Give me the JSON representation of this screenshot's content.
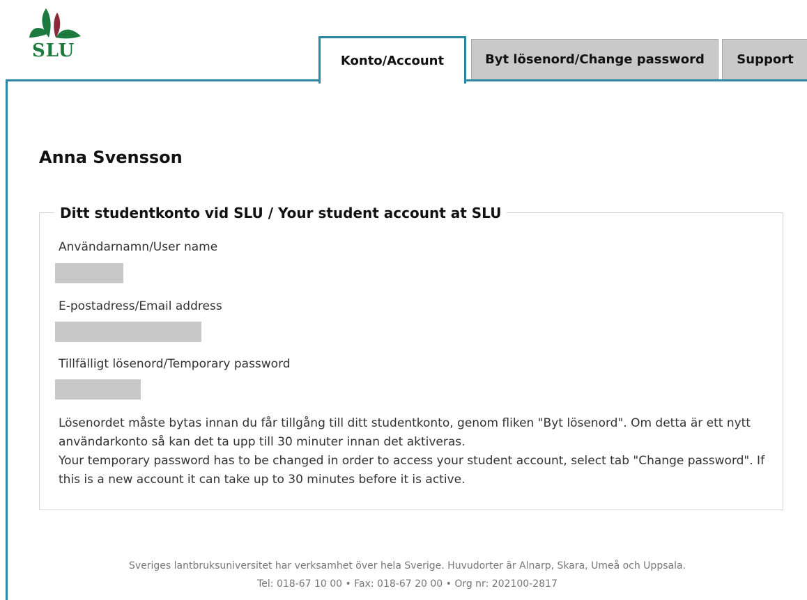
{
  "logo": {
    "text": "SLU"
  },
  "tabs": [
    {
      "label": "Konto/Account",
      "active": true
    },
    {
      "label": "Byt lösenord/Change password",
      "active": false
    },
    {
      "label": "Support",
      "active": false
    }
  ],
  "user": {
    "name": "Anna Svensson"
  },
  "account_panel": {
    "title": "Ditt studentkonto vid SLU / Your student account at SLU",
    "fields": [
      {
        "label": "Användarnamn/User name"
      },
      {
        "label": "E-postadress/Email address"
      },
      {
        "label": "Tillfälligt lösenord/Temporary password"
      }
    ],
    "info_sv": "Lösenordet måste bytas innan du får tillgång till ditt studentkonto, genom fliken \"Byt lösenord\". Om detta är ett nytt användarkonto så kan det ta upp till 30 minuter innan det aktiveras.",
    "info_en": "Your temporary password has to be changed in order to access your student account, select tab \"Change password\". If this is a new account it can take up to 30 minutes before it is active."
  },
  "footer": {
    "line1": "Sveriges lantbruksuniversitet har verksamhet över hela Sverige. Huvudorter är Alnarp, Skara, Umeå och Uppsala.",
    "line2": "Tel: 018-67 10 00 • Fax: 018-67 20 00 • Org nr: 202100-2817"
  },
  "colors": {
    "accent": "#2d86a4",
    "tab_inactive": "#c9c9c9",
    "logo_green": "#1d7a3e",
    "logo_red": "#8b2a3c",
    "masked": "#c8c8c8"
  }
}
